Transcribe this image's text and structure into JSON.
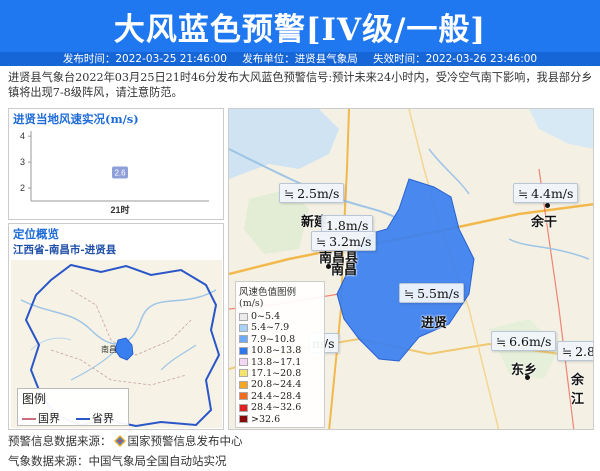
{
  "header": {
    "title": "大风蓝色预警[IV级/一般]",
    "publish_time": "发布时间：2022-03-25 21:46:00",
    "publisher": "发布单位：进贤县气象局",
    "expire_time": "失效时间：2022-03-26 23:46:00"
  },
  "description": "进贤县气象台2022年03月25日21时46分发布大风蓝色预警信号:预计未来24小时内，受冷空气南下影响，我县部分乡镇将出现7-8级阵风，请注意防范。",
  "wind_panel": {
    "title": "进贤当地风速实况(m/s)"
  },
  "chart_data": {
    "type": "line",
    "title": "进贤当地风速实况(m/s)",
    "categories": [
      "21时"
    ],
    "values": [
      2.6
    ],
    "ylim": [
      1.5,
      4.2
    ],
    "yticks": [
      2,
      3,
      4
    ],
    "ylabel": "",
    "xlabel": "",
    "data_labels": [
      "2.6"
    ]
  },
  "location_panel": {
    "title": "定位概览",
    "path": "江西省-南昌市-进贤县",
    "map_city": "南昌",
    "legend_title": "图例",
    "legend_county": "国界",
    "legend_province": "省界"
  },
  "main_map": {
    "wind_labels": [
      {
        "id": "xinjian",
        "text": "2.5m/s"
      },
      {
        "id": "nanchang_a",
        "text": "1.8m/s"
      },
      {
        "id": "nanchang_b",
        "text": "3.2m/s"
      },
      {
        "id": "yugan",
        "text": "4.4m/s"
      },
      {
        "id": "jinxian",
        "text": "5.5m/s"
      },
      {
        "id": "dongxiang",
        "text": "6.6m/s"
      },
      {
        "id": "linchuan",
        "text": "m/s"
      },
      {
        "id": "yujiang",
        "text": "2.8"
      }
    ],
    "cities": {
      "xinjian": "新建",
      "nanchang_county": "南昌县",
      "nanchang": "南昌",
      "yugan": "余干",
      "jinxian": "进贤",
      "dongxiang": "东乡",
      "yujiang": "余江"
    },
    "scale_title": "风速色值图例 (m/s)",
    "scale": [
      {
        "label": "0~5.4",
        "color": "#ececec"
      },
      {
        "label": "5.4~7.9",
        "color": "#a8d2f5"
      },
      {
        "label": "7.9~10.8",
        "color": "#6eaaf5"
      },
      {
        "label": "10.8~13.8",
        "color": "#2f78ec"
      },
      {
        "label": "13.8~17.1",
        "color": "#f5d6f5"
      },
      {
        "label": "17.1~20.8",
        "color": "#f5e36e"
      },
      {
        "label": "20.8~24.4",
        "color": "#f5a623"
      },
      {
        "label": "24.4~28.4",
        "color": "#f26b1d"
      },
      {
        "label": "28.4~32.6",
        "color": "#e02020"
      },
      {
        "label": ">32.6",
        "color": "#8b0a0a"
      }
    ],
    "warning_color": "#3a7ff0"
  },
  "footer": {
    "source_warning_prefix": "预警信息数据来源：",
    "source_warning_name": "国家预警信息发布中心",
    "source_weather": "气象数据来源：中国气象局全国自动站实况"
  }
}
